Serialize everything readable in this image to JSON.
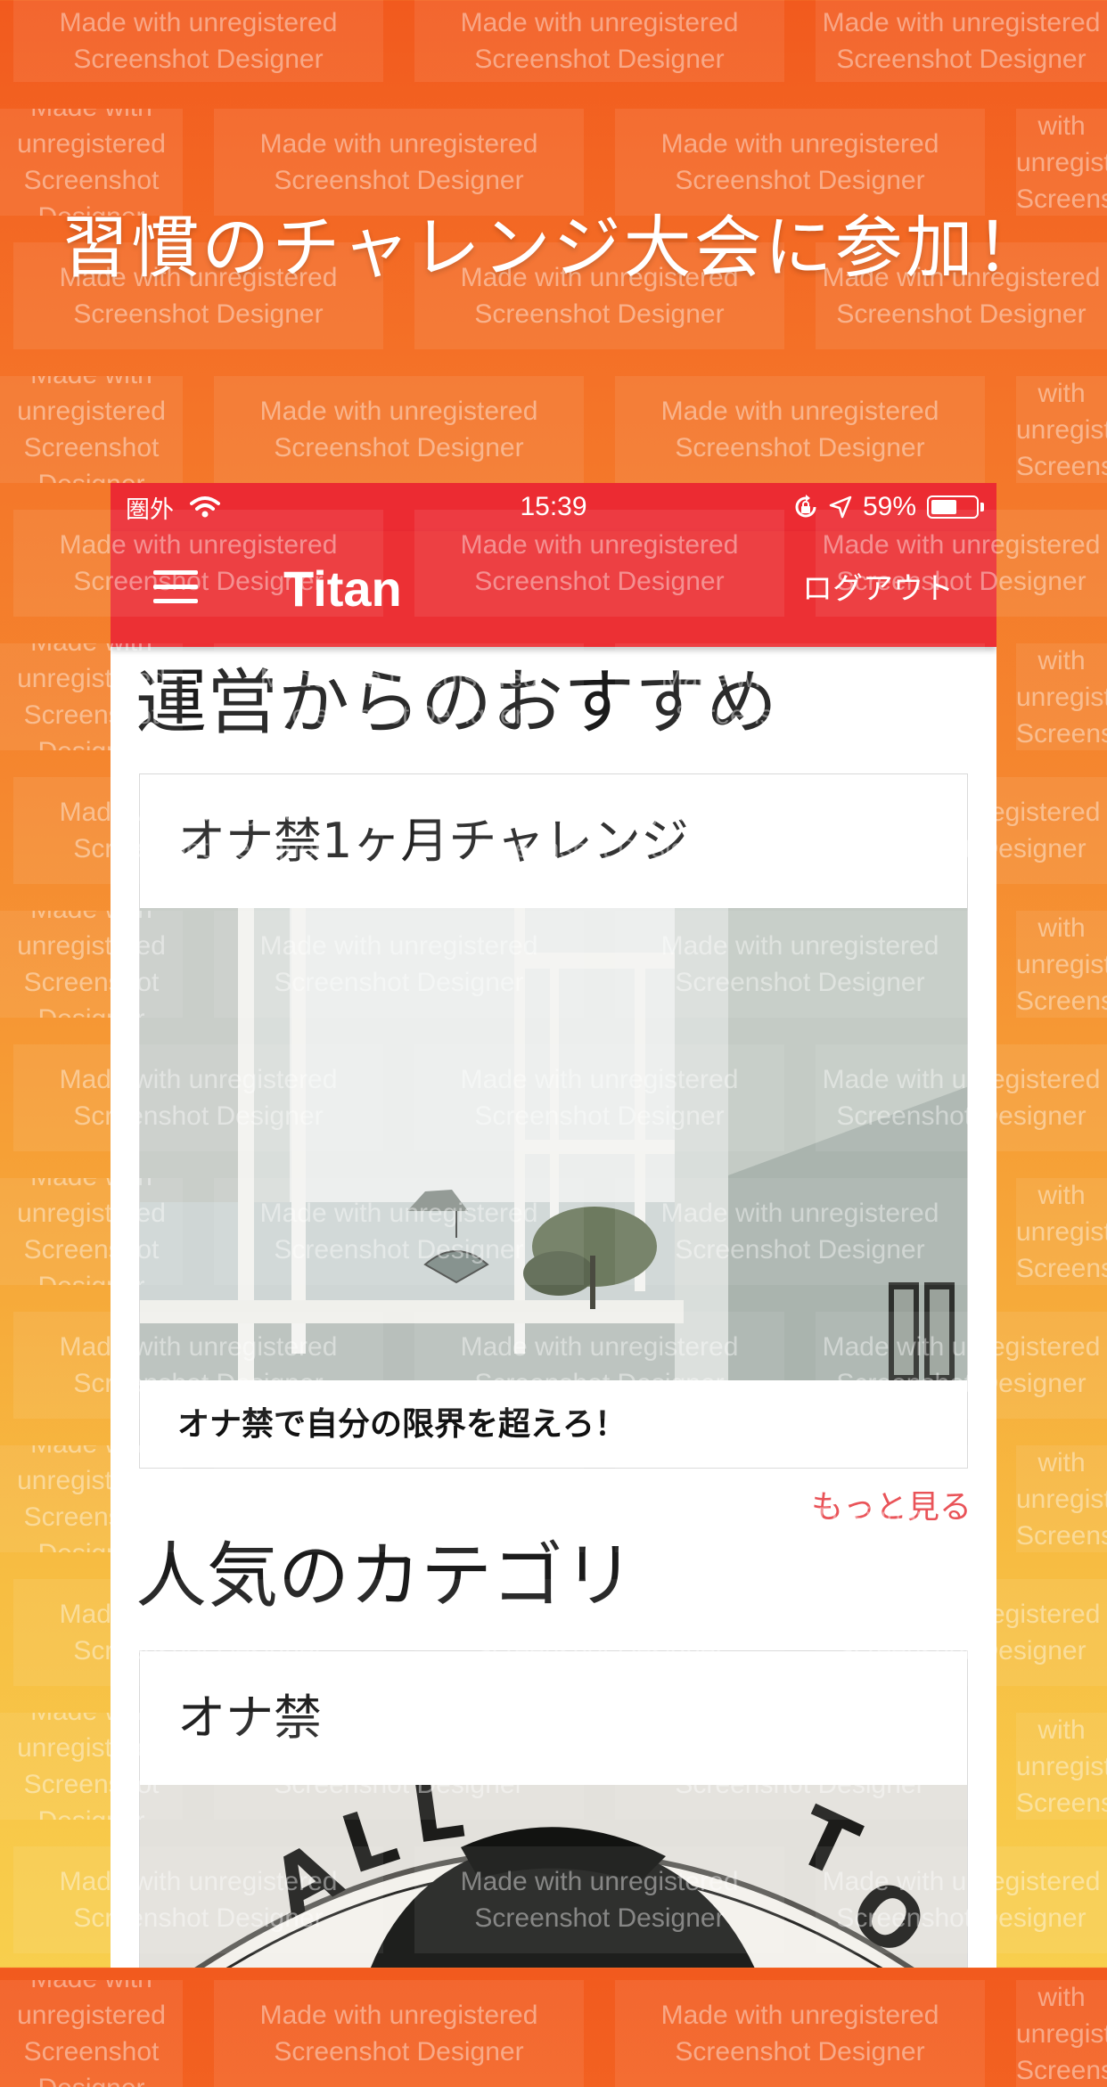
{
  "headline": "習慣のチャレンジ大会に参加！",
  "watermark": {
    "line1": "Made with unregistered",
    "line2": "Screenshot Designer"
  },
  "status_bar": {
    "carrier": "圏外",
    "time": "15:39",
    "battery_percent": "59%",
    "battery_level": 0.59
  },
  "nav": {
    "brand": "Titan",
    "logout": "ログアウト"
  },
  "sections": {
    "recommended": {
      "title": "運営からのおすすめ",
      "card_title": "オナ禁1ヶ月チャレンジ",
      "card_description": "オナ禁で自分の限界を超えろ！",
      "more_link": "もっと見る"
    },
    "popular": {
      "title": "人気のカテゴリ",
      "card_title": "オナ禁"
    }
  },
  "colors": {
    "accent": "#ec3034",
    "link": "#e8454a",
    "gradient_top": "#f25a1e",
    "gradient_bottom": "#f8cf4d"
  }
}
